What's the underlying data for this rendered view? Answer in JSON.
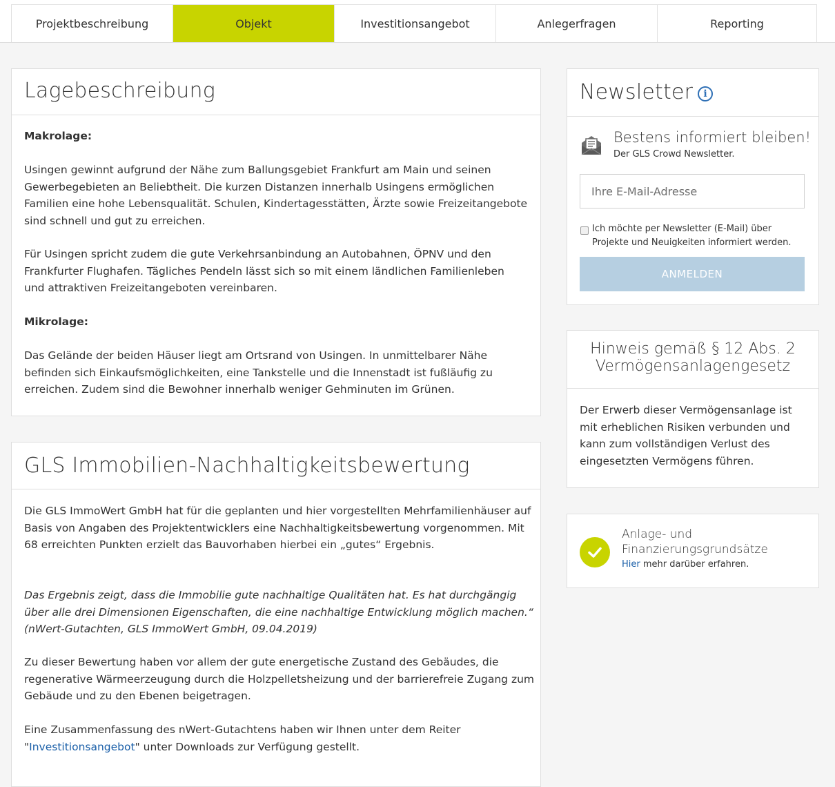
{
  "tabs": [
    {
      "label": "Projektbeschreibung",
      "active": false
    },
    {
      "label": "Objekt",
      "active": true
    },
    {
      "label": "Investitionsangebot",
      "active": false
    },
    {
      "label": "Anlegerfragen",
      "active": false
    },
    {
      "label": "Reporting",
      "active": false
    }
  ],
  "colors": {
    "accent": "#c8d400",
    "link": "#1a5fa8",
    "button_disabled": "#b6cfe1"
  },
  "lage": {
    "title": "Lagebeschreibung",
    "makro_heading": "Makrolage:",
    "makro_p1": "Usingen gewinnt aufgrund der Nähe zum Ballungsgebiet Frankfurt am Main und seinen Gewerbegebieten an Beliebtheit. Die kurzen Distanzen innerhalb Usingens ermöglichen Familien eine hohe Lebensqualität. Schulen, Kindertagesstätten, Ärzte sowie Freizeitangebote sind schnell und gut zu erreichen.",
    "makro_p2": "Für Usingen spricht zudem die gute Verkehrsanbindung an Autobahnen, ÖPNV und den Frankfurter Flughafen. Tägliches Pendeln lässt sich so mit einem ländlichen Familienleben und attraktiven Freizeitangeboten vereinbaren.",
    "mikro_heading": "Mikrolage:",
    "mikro_p1": "Das Gelände der beiden Häuser liegt am Ortsrand von Usingen. In unmittelbarer Nähe befinden sich Einkaufsmöglichkeiten, eine Tankstelle und die Innenstadt ist fußläufig zu erreichen. Zudem sind die Bewohner innerhalb weniger Gehminuten im Grünen."
  },
  "nachhaltigkeit": {
    "title": "GLS Immobilien-Nachhaltigkeitsbewertung",
    "p1": "Die GLS ImmoWert GmbH hat für die geplanten und hier vorgestellten Mehrfamilienhäuser auf Basis von Angaben des Projektentwicklers eine Nachhaltigkeitsbewertung vorgenommen. Mit 68 erreichten Punkten erzielt das Bauvorhaben hierbei ein „gutes“ Ergebnis.",
    "quote": "Das Ergebnis zeigt, dass die Immobilie gute nachhaltige Qualitäten hat. Es hat durchgängig über alle drei Dimensionen Eigenschaften, die eine nachhaltige Entwicklung möglich machen.“ (nWert-Gutachten, GLS ImmoWert GmbH, 09.04.2019)",
    "p3": "Zu dieser Bewertung haben vor allem der gute energetische Zustand des Gebäudes, die regenerative Wärmeerzeugung durch die Holzpelletsheizung und der barrierefreie Zugang zum Gebäude und zu den Ebenen beigetragen.",
    "p4_before": "Eine Zusammenfassung des nWert-Gutachtens haben wir Ihnen unter dem Reiter \"",
    "p4_link": "Investitionsangebot",
    "p4_after": "\" unter Downloads zur Verfügung gestellt."
  },
  "newsletter": {
    "title": "Newsletter",
    "info_icon": "info-icon",
    "mail_icon": "envelope-open-icon",
    "tagline": "Bestens informiert bleiben!",
    "subline": "Der GLS Crowd Newsletter.",
    "email_placeholder": "Ihre E-Mail-Adresse",
    "email_value": "",
    "consent_label": "Ich möchte per Newsletter (E-Mail) über Projekte und Neuigkeiten informiert werden.",
    "consent_checked": false,
    "button_label": "ANMELDEN"
  },
  "hinweis": {
    "title": "Hinweis gemäß § 12 Abs. 2 Vermögensanlagengesetz",
    "text": "Der Erwerb dieser Vermögensanlage ist mit erheblichen Risiken verbunden und kann zum vollständigen Verlust des eingesetzten Vermögens führen."
  },
  "grundsaetze": {
    "icon": "check-circle-icon",
    "title": "Anlage- und Finanzierungsgrundsätze",
    "link_label": "Hier",
    "link_after": " mehr darüber erfahren."
  }
}
